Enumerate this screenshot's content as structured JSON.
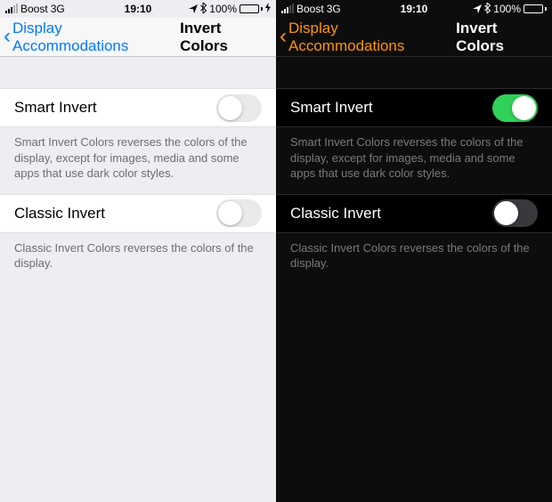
{
  "status": {
    "carrier": "Boost",
    "network": "3G",
    "time": "19:10",
    "battery_pct": "100%"
  },
  "nav": {
    "back_label": "Display Accommodations",
    "title": "Invert Colors"
  },
  "smart": {
    "label": "Smart Invert",
    "footer": "Smart Invert Colors reverses the colors of the display, except for images, media and some apps that use dark color styles."
  },
  "classic": {
    "label": "Classic Invert",
    "footer": "Classic Invert Colors reverses the colors of the display."
  },
  "light_state": {
    "smart_on": false,
    "classic_on": false
  },
  "dark_state": {
    "smart_on": true,
    "classic_on": false
  }
}
